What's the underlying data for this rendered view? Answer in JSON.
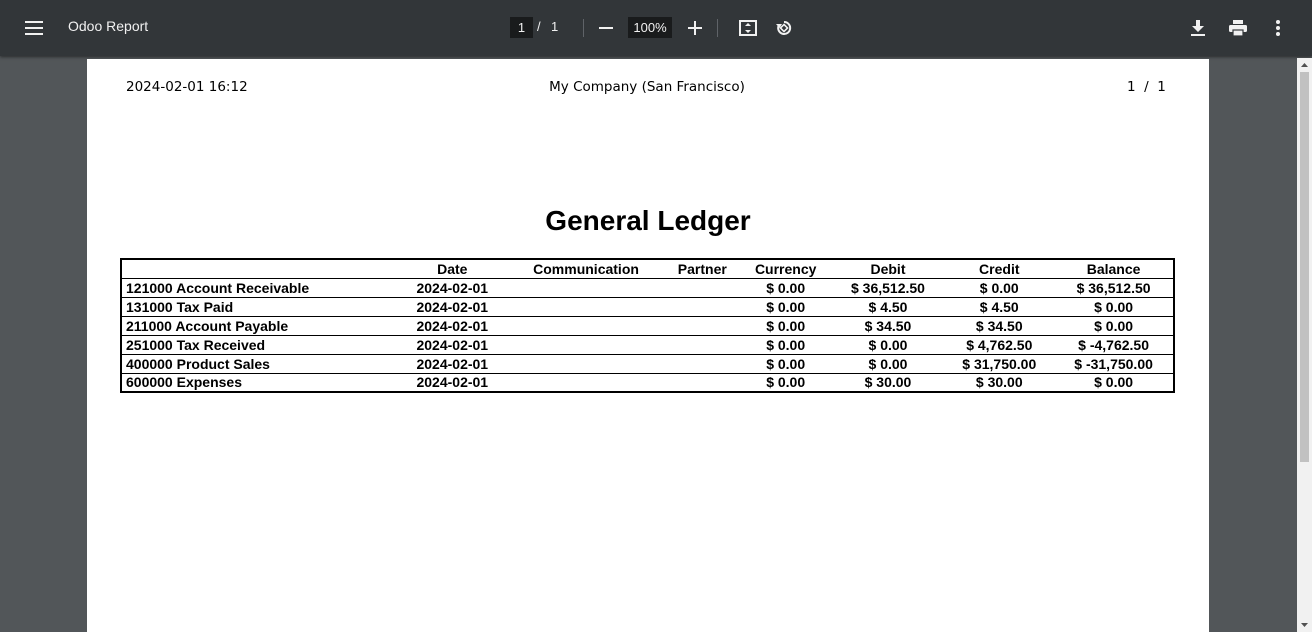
{
  "toolbar": {
    "title": "Odoo Report",
    "current_page": "1",
    "page_separator": "/",
    "total_pages": "1",
    "zoom": "100%"
  },
  "header": {
    "datetime": "2024-02-01 16:12",
    "company": "My Company (San Francisco)",
    "page_counter": "1  /  1"
  },
  "report": {
    "title": "General Ledger",
    "columns": [
      "",
      "Date",
      "Communication",
      "Partner",
      "Currency",
      "Debit",
      "Credit",
      "Balance"
    ],
    "rows": [
      {
        "account": "121000 Account Receivable",
        "date": "2024-02-01",
        "communication": "",
        "partner": "",
        "currency": "$ 0.00",
        "debit": "$ 36,512.50",
        "credit": "$ 0.00",
        "balance": "$ 36,512.50"
      },
      {
        "account": "131000 Tax Paid",
        "date": "2024-02-01",
        "communication": "",
        "partner": "",
        "currency": "$ 0.00",
        "debit": "$ 4.50",
        "credit": "$ 4.50",
        "balance": "$ 0.00"
      },
      {
        "account": "211000 Account Payable",
        "date": "2024-02-01",
        "communication": "",
        "partner": "",
        "currency": "$ 0.00",
        "debit": "$ 34.50",
        "credit": "$ 34.50",
        "balance": "$ 0.00"
      },
      {
        "account": "251000 Tax Received",
        "date": "2024-02-01",
        "communication": "",
        "partner": "",
        "currency": "$ 0.00",
        "debit": "$ 0.00",
        "credit": "$ 4,762.50",
        "balance": "$ -4,762.50"
      },
      {
        "account": "400000 Product Sales",
        "date": "2024-02-01",
        "communication": "",
        "partner": "",
        "currency": "$ 0.00",
        "debit": "$ 0.00",
        "credit": "$ 31,750.00",
        "balance": "$ -31,750.00"
      },
      {
        "account": "600000 Expenses",
        "date": "2024-02-01",
        "communication": "",
        "partner": "",
        "currency": "$ 0.00",
        "debit": "$ 30.00",
        "credit": "$ 30.00",
        "balance": "$ 0.00"
      }
    ]
  },
  "icons": {
    "menu": "hamburger-menu-icon",
    "zoom_out": "minus-icon",
    "zoom_in": "plus-icon",
    "fit": "fit-to-page-icon",
    "rotate": "rotate-icon",
    "download": "download-icon",
    "print": "print-icon",
    "more": "more-vert-icon"
  },
  "colors": {
    "toolbar_bg": "#323639",
    "viewer_bg": "#525659",
    "page_bg": "#ffffff"
  }
}
